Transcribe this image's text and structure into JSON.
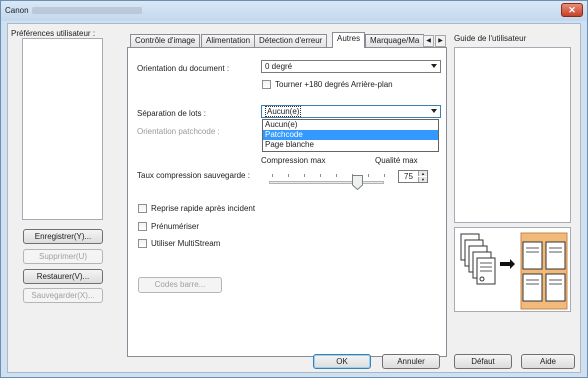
{
  "window": {
    "title_prefix": "Canon",
    "close_label": "✕"
  },
  "user_prefs": {
    "label": "Préférences utilisateur :",
    "buttons": {
      "save": "Enregistrer(Y)...",
      "delete": "Supprimer(U)",
      "restore": "Restaurer(V)...",
      "backup": "Sauvegarder(X)..."
    }
  },
  "tabs": [
    {
      "label": "Contrôle d'image",
      "active": false
    },
    {
      "label": "Alimentation",
      "active": false
    },
    {
      "label": "Détection d'erreur",
      "active": false
    },
    {
      "label": "Autres",
      "active": true
    },
    {
      "label": "Marquage/Ma",
      "active": false
    }
  ],
  "autres": {
    "orientation_label": "Orientation du document :",
    "orientation_value": "0 degré",
    "rotate_back_label": "Tourner +180 degrés Arrière-plan",
    "separation_label": "Séparation de lots :",
    "separation_value": "Aucun(e)",
    "separation_options": [
      "Aucun(e)",
      "Patchcode",
      "Page blanche"
    ],
    "separation_highlighted": "Patchcode",
    "patchcode_label": "Orientation patchcode :",
    "compression_max_label": "Compression max",
    "quality_max_label": "Qualité max",
    "compression_rate_label": "Taux compression sauvegarde :",
    "compression_rate_value": "75",
    "rapid_recovery_label": "Reprise rapide après incident",
    "prescan_label": "Prénumériser",
    "multistream_label": "Utiliser MultiStream",
    "barcode_button": "Codes barre..."
  },
  "guide": {
    "label": "Guide de l'utilisateur"
  },
  "footer": {
    "ok": "OK",
    "cancel": "Annuler",
    "default": "Défaut",
    "help": "Aide"
  }
}
